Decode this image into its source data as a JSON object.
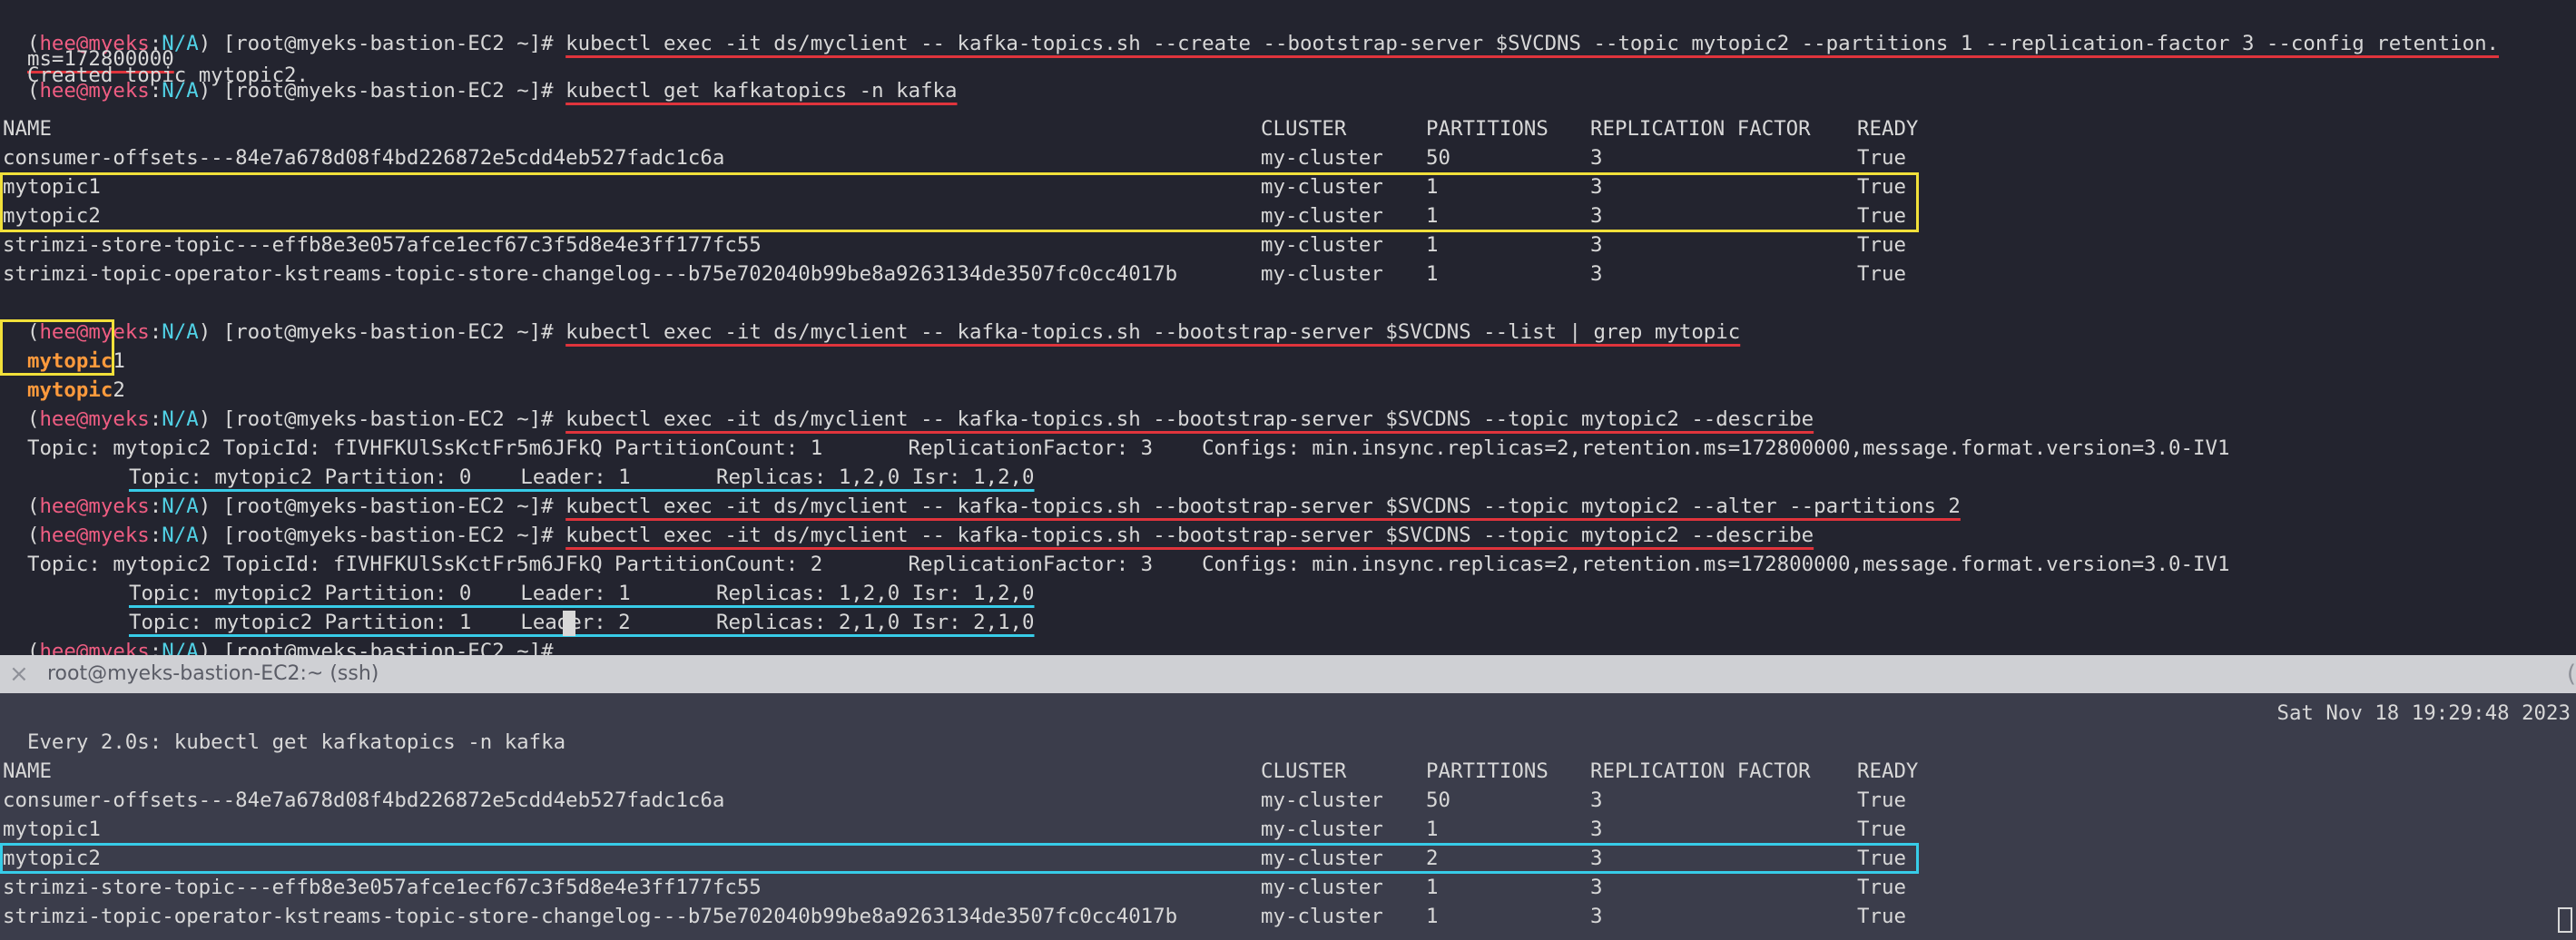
{
  "top": {
    "prompt": {
      "user": "hee@myeks",
      "ns": "N/A",
      "host": "[root@myeks-bastion-EC2 ~]# "
    },
    "cmd1": "kubectl exec -it ds/myclient -- kafka-topics.sh --create --bootstrap-server $SVCDNS --topic mytopic2 --partitions 1 --replication-factor 3 --config retention.",
    "cmd1_wrap": "ms=172800000",
    "created_msg": "Created topic mytopic2.",
    "cmd2": "kubectl get kafkatopics -n kafka",
    "table": {
      "headers": [
        "NAME",
        "CLUSTER",
        "PARTITIONS",
        "REPLICATION FACTOR",
        "READY"
      ],
      "rows": [
        [
          "consumer-offsets---84e7a678d08f4bd226872e5cdd4eb527fadc1c6a",
          "my-cluster",
          "50",
          "3",
          "True"
        ],
        [
          "mytopic1",
          "my-cluster",
          "1",
          "3",
          "True"
        ],
        [
          "mytopic2",
          "my-cluster",
          "1",
          "3",
          "True"
        ],
        [
          "strimzi-store-topic---effb8e3e057afce1ecf67c3f5d8e4e3ff177fc55",
          "my-cluster",
          "1",
          "3",
          "True"
        ],
        [
          "strimzi-topic-operator-kstreams-topic-store-changelog---b75e702040b99be8a9263134de3507fc0cc4017b",
          "my-cluster",
          "1",
          "3",
          "True"
        ]
      ]
    },
    "cmd3": "kubectl exec -it ds/myclient -- kafka-topics.sh --bootstrap-server $SVCDNS --list | grep mytopic",
    "grep_out": [
      {
        "match": "mytopic",
        "rest": "1"
      },
      {
        "match": "mytopic",
        "rest": "2"
      }
    ],
    "cmd4": "kubectl exec -it ds/myclient -- kafka-topics.sh --bootstrap-server $SVCDNS --topic mytopic2 --describe",
    "describe1": "Topic: mytopic2 TopicId: fIVHFKUlSsKctFr5m6JFkQ PartitionCount: 1       ReplicationFactor: 3    Configs: min.insync.replicas=2,retention.ms=172800000,message.format.version=3.0-IV1",
    "describe1_p0": "Topic: mytopic2 Partition: 0    Leader: 1       Replicas: 1,2,0 Isr: 1,2,0",
    "cmd5": "kubectl exec -it ds/myclient -- kafka-topics.sh --bootstrap-server $SVCDNS --topic mytopic2 --alter --partitions 2",
    "cmd6": "kubectl exec -it ds/myclient -- kafka-topics.sh --bootstrap-server $SVCDNS --topic mytopic2 --describe",
    "describe2": "Topic: mytopic2 TopicId: fIVHFKUlSsKctFr5m6JFkQ PartitionCount: 2       ReplicationFactor: 3    Configs: min.insync.replicas=2,retention.ms=172800000,message.format.version=3.0-IV1",
    "describe2_p0": "Topic: mytopic2 Partition: 0    Leader: 1       Replicas: 1,2,0 Isr: 1,2,0",
    "describe2_p1": "Topic: mytopic2 Partition: 1    Leader: 2       Replicas: 2,1,0 Isr: 2,1,0"
  },
  "divider": {
    "close_icon": "×",
    "title": "root@myeks-bastion-EC2:~ (ssh)",
    "edge_glyph": "("
  },
  "bottom": {
    "watch_header": "Every 2.0s: kubectl get kafkatopics -n kafka",
    "timestamp": "Sat Nov 18 19:29:48 2023",
    "table": {
      "headers": [
        "NAME",
        "CLUSTER",
        "PARTITIONS",
        "REPLICATION FACTOR",
        "READY"
      ],
      "rows": [
        [
          "consumer-offsets---84e7a678d08f4bd226872e5cdd4eb527fadc1c6a",
          "my-cluster",
          "50",
          "3",
          "True"
        ],
        [
          "mytopic1",
          "my-cluster",
          "1",
          "3",
          "True"
        ],
        [
          "mytopic2",
          "my-cluster",
          "2",
          "3",
          "True"
        ],
        [
          "strimzi-store-topic---effb8e3e057afce1ecf67c3f5d8e4e3ff177fc55",
          "my-cluster",
          "1",
          "3",
          "True"
        ],
        [
          "strimzi-topic-operator-kstreams-topic-store-changelog---b75e702040b99be8a9263134de3507fc0cc4017b",
          "my-cluster",
          "1",
          "3",
          "True"
        ]
      ]
    }
  },
  "colors": {
    "highlight_yellow": "#f1e03a",
    "highlight_cyan": "#37cce8",
    "underline_red": "#e0343c",
    "prompt_user": "#ef5d82",
    "prompt_ns": "#51d2e6"
  }
}
